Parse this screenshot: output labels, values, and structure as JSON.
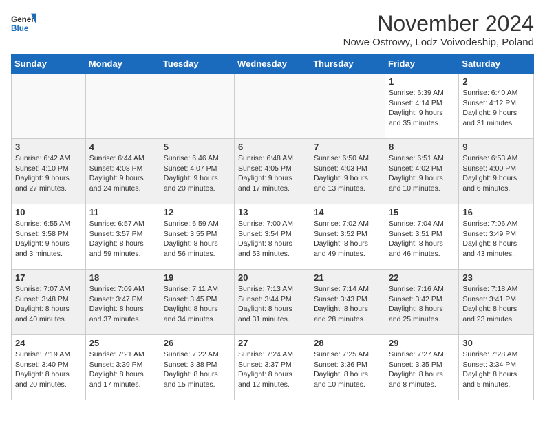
{
  "logo": {
    "general": "General",
    "blue": "Blue"
  },
  "title": "November 2024",
  "subtitle": "Nowe Ostrowy, Lodz Voivodeship, Poland",
  "days_of_week": [
    "Sunday",
    "Monday",
    "Tuesday",
    "Wednesday",
    "Thursday",
    "Friday",
    "Saturday"
  ],
  "weeks": [
    [
      {
        "day": "",
        "info": ""
      },
      {
        "day": "",
        "info": ""
      },
      {
        "day": "",
        "info": ""
      },
      {
        "day": "",
        "info": ""
      },
      {
        "day": "",
        "info": ""
      },
      {
        "day": "1",
        "info": "Sunrise: 6:39 AM\nSunset: 4:14 PM\nDaylight: 9 hours and 35 minutes."
      },
      {
        "day": "2",
        "info": "Sunrise: 6:40 AM\nSunset: 4:12 PM\nDaylight: 9 hours and 31 minutes."
      }
    ],
    [
      {
        "day": "3",
        "info": "Sunrise: 6:42 AM\nSunset: 4:10 PM\nDaylight: 9 hours and 27 minutes."
      },
      {
        "day": "4",
        "info": "Sunrise: 6:44 AM\nSunset: 4:08 PM\nDaylight: 9 hours and 24 minutes."
      },
      {
        "day": "5",
        "info": "Sunrise: 6:46 AM\nSunset: 4:07 PM\nDaylight: 9 hours and 20 minutes."
      },
      {
        "day": "6",
        "info": "Sunrise: 6:48 AM\nSunset: 4:05 PM\nDaylight: 9 hours and 17 minutes."
      },
      {
        "day": "7",
        "info": "Sunrise: 6:50 AM\nSunset: 4:03 PM\nDaylight: 9 hours and 13 minutes."
      },
      {
        "day": "8",
        "info": "Sunrise: 6:51 AM\nSunset: 4:02 PM\nDaylight: 9 hours and 10 minutes."
      },
      {
        "day": "9",
        "info": "Sunrise: 6:53 AM\nSunset: 4:00 PM\nDaylight: 9 hours and 6 minutes."
      }
    ],
    [
      {
        "day": "10",
        "info": "Sunrise: 6:55 AM\nSunset: 3:58 PM\nDaylight: 9 hours and 3 minutes."
      },
      {
        "day": "11",
        "info": "Sunrise: 6:57 AM\nSunset: 3:57 PM\nDaylight: 8 hours and 59 minutes."
      },
      {
        "day": "12",
        "info": "Sunrise: 6:59 AM\nSunset: 3:55 PM\nDaylight: 8 hours and 56 minutes."
      },
      {
        "day": "13",
        "info": "Sunrise: 7:00 AM\nSunset: 3:54 PM\nDaylight: 8 hours and 53 minutes."
      },
      {
        "day": "14",
        "info": "Sunrise: 7:02 AM\nSunset: 3:52 PM\nDaylight: 8 hours and 49 minutes."
      },
      {
        "day": "15",
        "info": "Sunrise: 7:04 AM\nSunset: 3:51 PM\nDaylight: 8 hours and 46 minutes."
      },
      {
        "day": "16",
        "info": "Sunrise: 7:06 AM\nSunset: 3:49 PM\nDaylight: 8 hours and 43 minutes."
      }
    ],
    [
      {
        "day": "17",
        "info": "Sunrise: 7:07 AM\nSunset: 3:48 PM\nDaylight: 8 hours and 40 minutes."
      },
      {
        "day": "18",
        "info": "Sunrise: 7:09 AM\nSunset: 3:47 PM\nDaylight: 8 hours and 37 minutes."
      },
      {
        "day": "19",
        "info": "Sunrise: 7:11 AM\nSunset: 3:45 PM\nDaylight: 8 hours and 34 minutes."
      },
      {
        "day": "20",
        "info": "Sunrise: 7:13 AM\nSunset: 3:44 PM\nDaylight: 8 hours and 31 minutes."
      },
      {
        "day": "21",
        "info": "Sunrise: 7:14 AM\nSunset: 3:43 PM\nDaylight: 8 hours and 28 minutes."
      },
      {
        "day": "22",
        "info": "Sunrise: 7:16 AM\nSunset: 3:42 PM\nDaylight: 8 hours and 25 minutes."
      },
      {
        "day": "23",
        "info": "Sunrise: 7:18 AM\nSunset: 3:41 PM\nDaylight: 8 hours and 23 minutes."
      }
    ],
    [
      {
        "day": "24",
        "info": "Sunrise: 7:19 AM\nSunset: 3:40 PM\nDaylight: 8 hours and 20 minutes."
      },
      {
        "day": "25",
        "info": "Sunrise: 7:21 AM\nSunset: 3:39 PM\nDaylight: 8 hours and 17 minutes."
      },
      {
        "day": "26",
        "info": "Sunrise: 7:22 AM\nSunset: 3:38 PM\nDaylight: 8 hours and 15 minutes."
      },
      {
        "day": "27",
        "info": "Sunrise: 7:24 AM\nSunset: 3:37 PM\nDaylight: 8 hours and 12 minutes."
      },
      {
        "day": "28",
        "info": "Sunrise: 7:25 AM\nSunset: 3:36 PM\nDaylight: 8 hours and 10 minutes."
      },
      {
        "day": "29",
        "info": "Sunrise: 7:27 AM\nSunset: 3:35 PM\nDaylight: 8 hours and 8 minutes."
      },
      {
        "day": "30",
        "info": "Sunrise: 7:28 AM\nSunset: 3:34 PM\nDaylight: 8 hours and 5 minutes."
      }
    ]
  ]
}
